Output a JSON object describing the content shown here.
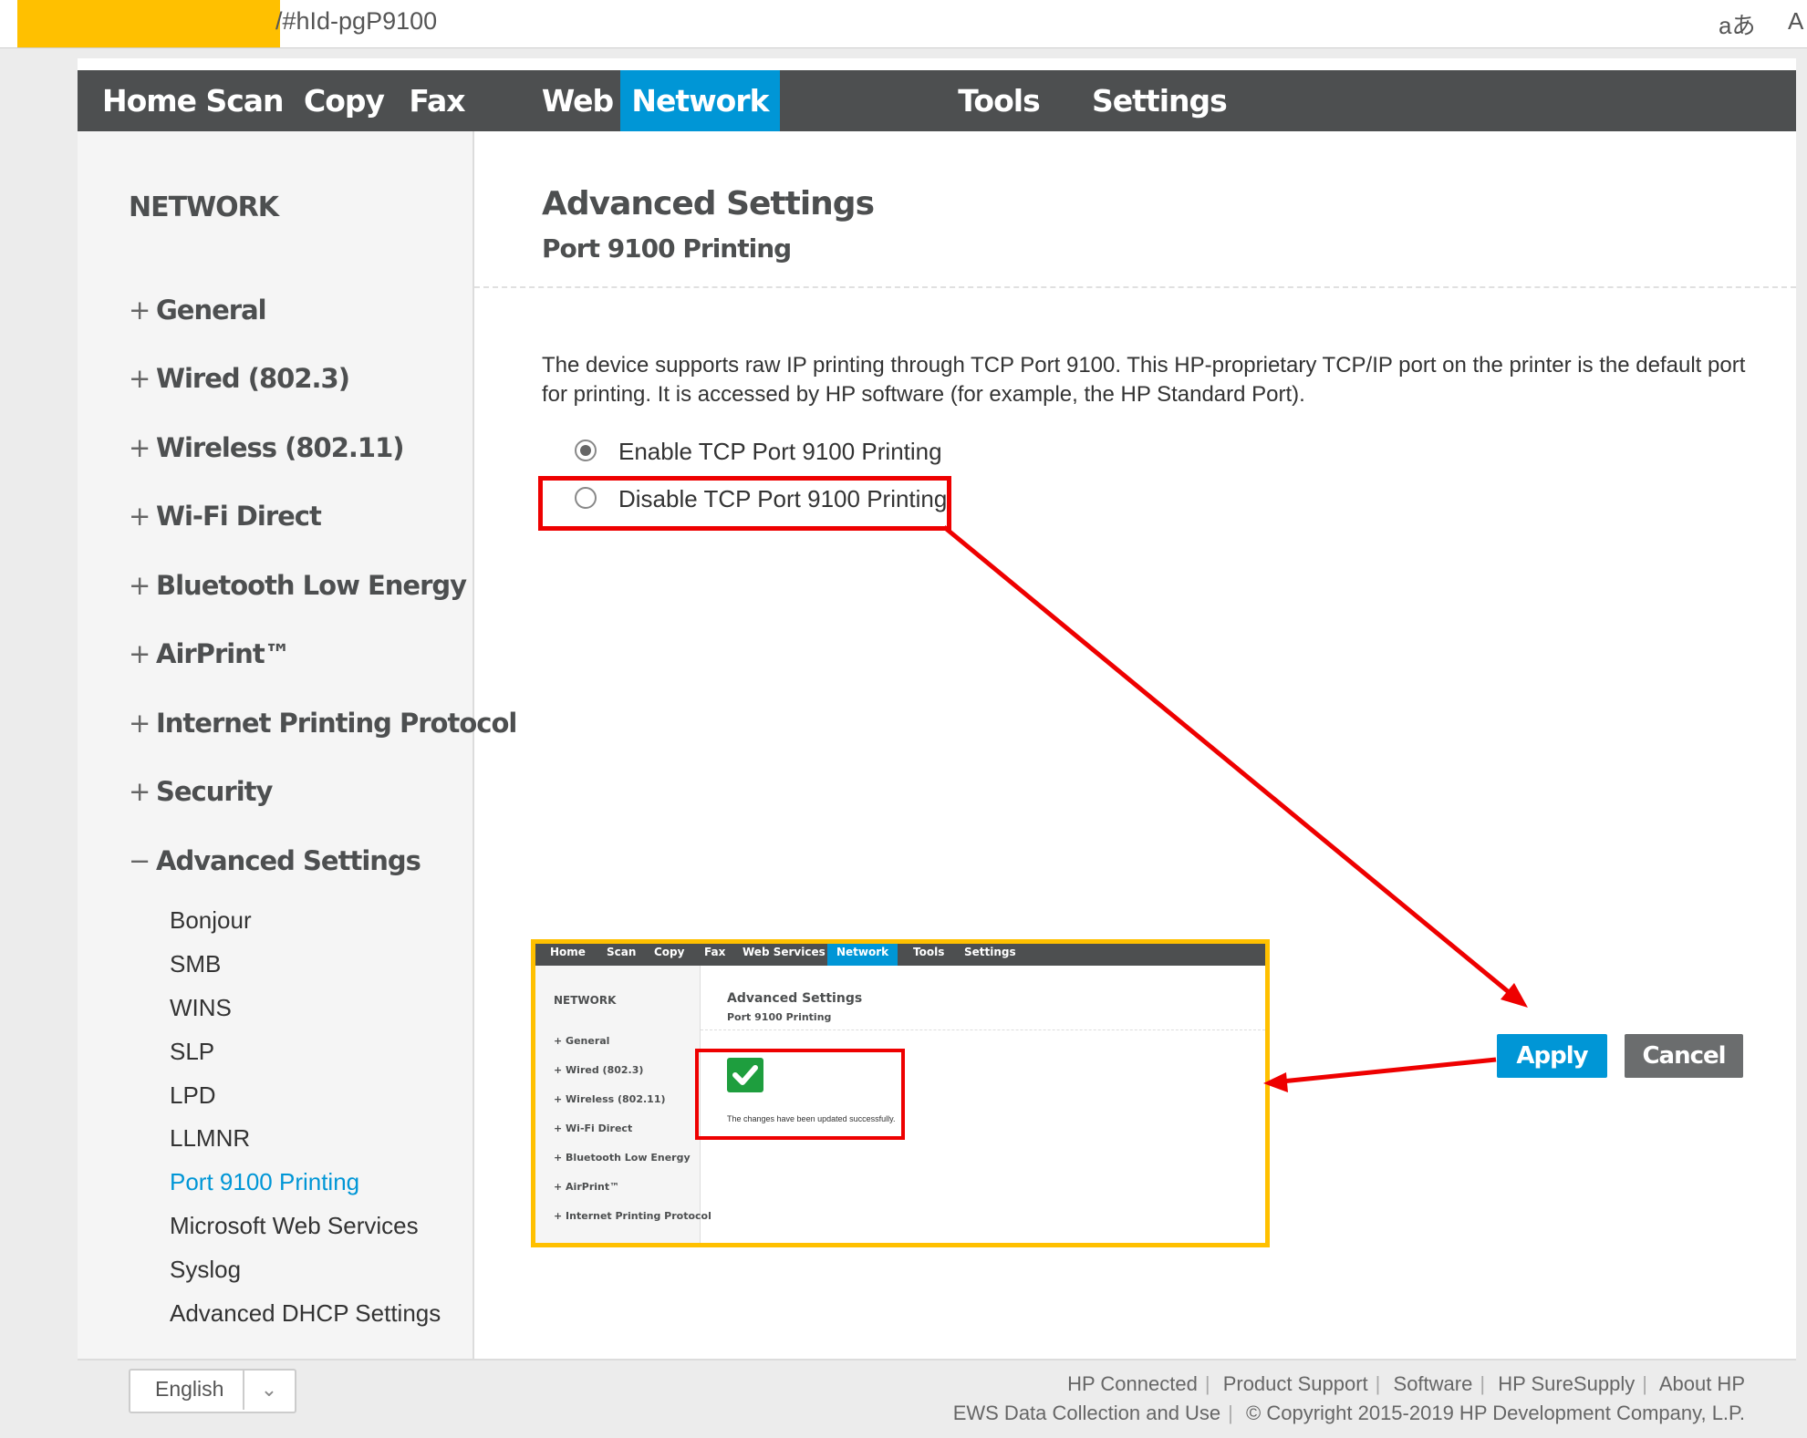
{
  "browser": {
    "address_text": "/#hId-pgP9100",
    "reader_icon_glyph": "aあ",
    "more_icon_glyph": "A"
  },
  "nav": {
    "items": [
      "Home",
      "Scan",
      "Copy",
      "Fax",
      "Web Services",
      "Network",
      "Tools",
      "Settings"
    ],
    "active": "Network"
  },
  "sidebar": {
    "title": "NETWORK",
    "main_items": [
      {
        "label": "General",
        "prefix": "+"
      },
      {
        "label": "Wired (802.3)",
        "prefix": "+"
      },
      {
        "label": "Wireless (802.11)",
        "prefix": "+"
      },
      {
        "label": "Wi-Fi Direct",
        "prefix": "+"
      },
      {
        "label": "Bluetooth Low Energy",
        "prefix": "+"
      },
      {
        "label": "AirPrint™",
        "prefix": "+"
      },
      {
        "label": "Internet Printing Protocol",
        "prefix": "+"
      },
      {
        "label": "Security",
        "prefix": "+"
      },
      {
        "label": "Advanced Settings",
        "prefix": "−"
      }
    ],
    "sub_items": [
      "Bonjour",
      "SMB",
      "WINS",
      "SLP",
      "LPD",
      "LLMNR",
      "Port 9100 Printing",
      "Microsoft Web Services",
      "Syslog",
      "Advanced DHCP Settings"
    ],
    "current_sub": "Port 9100 Printing"
  },
  "main": {
    "title": "Advanced Settings",
    "subtitle": "Port 9100 Printing",
    "description": "The device supports raw IP printing through TCP Port 9100. This HP-proprietary TCP/IP port on the printer is the default port for printing. It is accessed by HP software (for example, the HP Standard Port).",
    "options": [
      {
        "label": "Enable TCP Port 9100 Printing",
        "selected": true
      },
      {
        "label": "Disable TCP Port 9100 Printing",
        "selected": false
      }
    ],
    "apply_label": "Apply",
    "cancel_label": "Cancel"
  },
  "footer": {
    "language": "English",
    "links": [
      "HP Connected",
      "Product Support",
      "Software",
      "HP SureSupply",
      "About HP"
    ],
    "data_collection": "EWS Data Collection and Use",
    "copyright": "© Copyright 2015-2019 HP Development Company, L.P."
  },
  "inset": {
    "nav_items": [
      "Home",
      "Scan",
      "Copy",
      "Fax",
      "Web Services",
      "Network",
      "Tools",
      "Settings"
    ],
    "active": "Network",
    "side_title": "NETWORK",
    "side_items": [
      "General",
      "Wired (802.3)",
      "Wireless (802.11)",
      "Wi-Fi Direct",
      "Bluetooth Low Energy",
      "AirPrint™",
      "Internet Printing Protocol"
    ],
    "title": "Advanced Settings",
    "subtitle": "Port 9100 Printing",
    "message": "The changes have been updated successfully."
  },
  "colors": {
    "nav_bg": "#4d4f50",
    "accent": "#0096d6",
    "annotation_red": "#e00000",
    "highlight_yellow": "#ffc000",
    "success_green": "#1e9e3e"
  },
  "icons": {
    "success": "checkmark-icon",
    "chevron": "chevron-down-icon"
  }
}
